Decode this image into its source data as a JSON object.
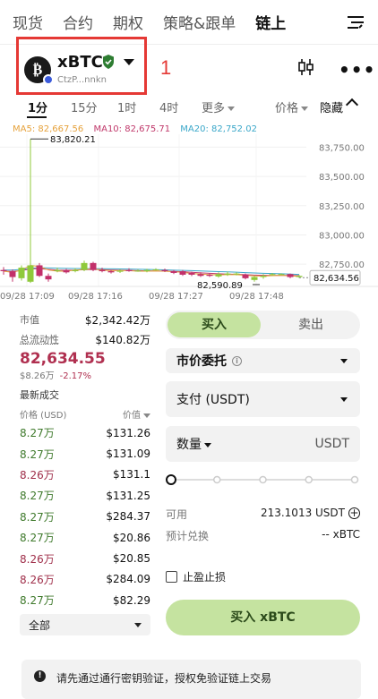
{
  "nav": {
    "items": [
      "现货",
      "合约",
      "期权",
      "策略&跟单",
      "链上"
    ],
    "active_index": 4
  },
  "coin": {
    "symbol": "xBTC",
    "address": "CtzP...nnkn",
    "annotation": "1"
  },
  "intervals": {
    "items": [
      "1分",
      "15分",
      "1时",
      "4时",
      "更多"
    ],
    "active_index": 0,
    "price_label": "价格",
    "hide_label": "隐藏"
  },
  "ma": {
    "ma5": "MA5: 82,667.56",
    "ma10": "MA10: 82,675.71",
    "ma20": "MA20: 82,752.02"
  },
  "chart_data": {
    "type": "candlestick",
    "y_ticks": [
      "83,750.00",
      "83,500.00",
      "83,250.00",
      "83,000.00",
      "82,750.00"
    ],
    "ylim": [
      82560,
      83860
    ],
    "x_ticks": [
      "09/28 17:09",
      "09/28 17:16",
      "09/28 17:27",
      "09/28 17:48"
    ],
    "high_label": "83,820.21",
    "low_label": "82,590.89",
    "last_price": "82,634.56",
    "candles": [
      {
        "o": 82700,
        "c": 82690,
        "h": 82725,
        "l": 82660
      },
      {
        "o": 82690,
        "c": 82640,
        "h": 82705,
        "l": 82600
      },
      {
        "o": 82630,
        "c": 82720,
        "h": 82740,
        "l": 82610
      },
      {
        "o": 82600,
        "c": 82740,
        "h": 83820,
        "l": 82590
      },
      {
        "o": 82740,
        "c": 82650,
        "h": 82760,
        "l": 82640
      },
      {
        "o": 82650,
        "c": 82620,
        "h": 82670,
        "l": 82600
      },
      {
        "o": 82690,
        "c": 82700,
        "h": 82720,
        "l": 82680
      },
      {
        "o": 82700,
        "c": 82680,
        "h": 82710,
        "l": 82670
      },
      {
        "o": 82690,
        "c": 82700,
        "h": 82715,
        "l": 82680
      },
      {
        "o": 82700,
        "c": 82760,
        "h": 82780,
        "l": 82690
      },
      {
        "o": 82760,
        "c": 82700,
        "h": 82770,
        "l": 82690
      },
      {
        "o": 82700,
        "c": 82690,
        "h": 82720,
        "l": 82680
      },
      {
        "o": 82690,
        "c": 82680,
        "h": 82700,
        "l": 82670
      },
      {
        "o": 82685,
        "c": 82695,
        "h": 82705,
        "l": 82675
      },
      {
        "o": 82700,
        "c": 82690,
        "h": 82715,
        "l": 82685
      },
      {
        "o": 82695,
        "c": 82695,
        "h": 82705,
        "l": 82685
      },
      {
        "o": 82690,
        "c": 82700,
        "h": 82710,
        "l": 82680
      },
      {
        "o": 82700,
        "c": 82705,
        "h": 82715,
        "l": 82695
      },
      {
        "o": 82700,
        "c": 82690,
        "h": 82712,
        "l": 82682
      },
      {
        "o": 82690,
        "c": 82675,
        "h": 82700,
        "l": 82665
      },
      {
        "o": 82690,
        "c": 82660,
        "h": 82700,
        "l": 82650
      },
      {
        "o": 82675,
        "c": 82660,
        "h": 82685,
        "l": 82648
      },
      {
        "o": 82665,
        "c": 82650,
        "h": 82680,
        "l": 82640
      },
      {
        "o": 82660,
        "c": 82650,
        "h": 82670,
        "l": 82640
      },
      {
        "o": 82645,
        "c": 82665,
        "h": 82680,
        "l": 82635
      },
      {
        "o": 82660,
        "c": 82670,
        "h": 82685,
        "l": 82650
      },
      {
        "o": 82665,
        "c": 82670,
        "h": 82680,
        "l": 82655
      },
      {
        "o": 82660,
        "c": 82630,
        "h": 82670,
        "l": 82620
      },
      {
        "o": 82615,
        "c": 82640,
        "h": 82650,
        "l": 82600
      },
      {
        "o": 82640,
        "c": 82650,
        "h": 82665,
        "l": 82625
      },
      {
        "o": 82660,
        "c": 82665,
        "h": 82675,
        "l": 82650
      },
      {
        "o": 82665,
        "c": 82665,
        "h": 82672,
        "l": 82658
      },
      {
        "o": 82665,
        "c": 82640,
        "h": 82670,
        "l": 82630
      },
      {
        "o": 82640,
        "c": 82650,
        "h": 82658,
        "l": 82632
      }
    ],
    "ma5_line": [
      82690,
      82680,
      82700,
      82740,
      82730,
      82700,
      82690,
      82690,
      82700,
      82705,
      82710,
      82700,
      82695,
      82695,
      82695,
      82690,
      82690,
      82692,
      82690,
      82685,
      82680,
      82670,
      82665,
      82660,
      82658,
      82660,
      82660,
      82655,
      82650,
      82648,
      82652,
      82655,
      82650,
      82645
    ],
    "ma10_line": [
      82690,
      82688,
      82695,
      82710,
      82712,
      82705,
      82700,
      82698,
      82700,
      82702,
      82705,
      82703,
      82700,
      82698,
      82697,
      82695,
      82693,
      82692,
      82690,
      82688,
      82685,
      82680,
      82676,
      82672,
      82668,
      82665,
      82663,
      82660,
      82657,
      82655,
      82654,
      82655,
      82654,
      82652
    ],
    "ma20_line": [
      82700,
      82700,
      82705,
      82715,
      82720,
      82718,
      82716,
      82714,
      82713,
      82712,
      82712,
      82711,
      82710,
      82709,
      82708,
      82706,
      82705,
      82703,
      82701,
      82699,
      82697,
      82695,
      82692,
      82689,
      82686,
      82684,
      82681,
      82678,
      82675,
      82672,
      82670,
      82668,
      82665,
      82662
    ]
  },
  "stats": {
    "market_cap_label": "市值",
    "market_cap_value": "$2,342.42万",
    "circ_label": "总流动性",
    "circ_value": "$140.82万",
    "price": "82,634.55",
    "price_usd": "$8.26万",
    "change": "-2.17%"
  },
  "trades": {
    "title": "最新成交",
    "col_price": "价格 (USD)",
    "col_value": "价值",
    "rows": [
      {
        "p": "8.27万",
        "v": "$131.26",
        "side": "g"
      },
      {
        "p": "8.27万",
        "v": "$131.09",
        "side": "g"
      },
      {
        "p": "8.26万",
        "v": "$131.1",
        "side": "r"
      },
      {
        "p": "8.27万",
        "v": "$131.25",
        "side": "g"
      },
      {
        "p": "8.27万",
        "v": "$284.37",
        "side": "g"
      },
      {
        "p": "8.27万",
        "v": "$20.86",
        "side": "g"
      },
      {
        "p": "8.26万",
        "v": "$20.85",
        "side": "r"
      },
      {
        "p": "8.26万",
        "v": "$284.09",
        "side": "r"
      },
      {
        "p": "8.27万",
        "v": "$82.29",
        "side": "g"
      }
    ],
    "filter": "全部"
  },
  "order": {
    "buy_tab": "买入",
    "sell_tab": "卖出",
    "order_type": "市价委托",
    "pay_label": "支付 (USDT)",
    "qty_label": "数量",
    "qty_unit": "USDT",
    "avail_label": "可用",
    "avail_value": "213.1013 USDT",
    "est_label": "预计兑换",
    "est_value": "-- xBTC",
    "tpsl_label": "止盈止损",
    "buy_button": "买入 xBTC",
    "slider_percent": 0
  },
  "notice": {
    "text": "请先通过通行密钥验证，授权免验证链上交易"
  },
  "colors": {
    "up": "#8fc93a",
    "down": "#c2306a",
    "accent": "#c5e3a0",
    "annotation": "#e53935"
  }
}
